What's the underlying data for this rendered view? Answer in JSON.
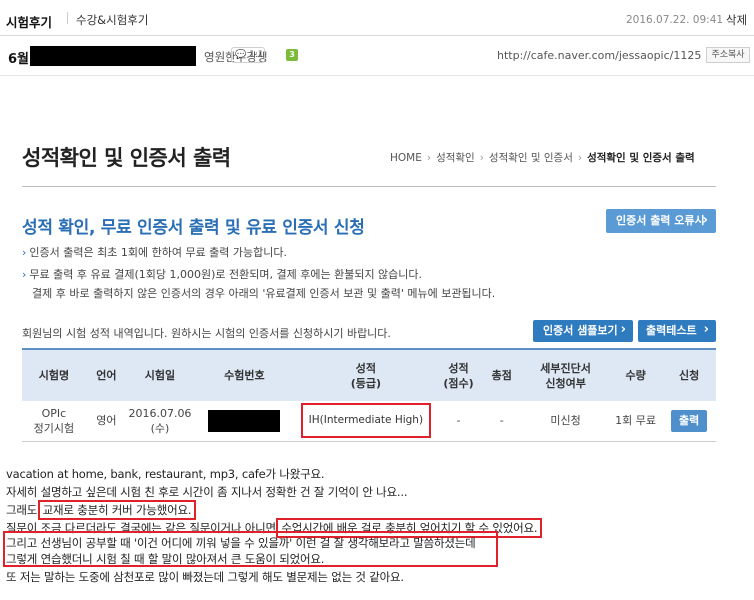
{
  "header": {
    "category": "시험후기",
    "subcategory": "수강&시험후기",
    "date": "2016.07.22. 09:41",
    "delete_label": "삭제"
  },
  "author": {
    "month": "6월",
    "role": "영원한수강생",
    "level_badge": "3",
    "chat_label": "1:1",
    "url": "http://cafe.naver.com/jessaopic/1125",
    "copy_label": "주소복사"
  },
  "embed": {
    "title": "성적확인 및 인증서 출력",
    "breadcrumb": [
      "HOME",
      "성적확인",
      "성적확인 및 인증서",
      "성적확인 및 인증서 출력"
    ],
    "heading": "성적 확인, 무료 인증서 출력 및 유료 인증서 신청",
    "error_button": "인증서 출력 오류시",
    "info_lines": [
      "인증서 출력은 최초 1회에 한하여 무료 출력 가능합니다.",
      "무료 출력 후 유료 결제(1회당 1,000원)로 전환되며, 결제 후에는 환불되지 않습니다.",
      "결제 후 바로 출력하지 않은 인증서의 경우 아래의 '유료결제 인증서 보관 및 출력' 메뉴에 보관됩니다."
    ],
    "member_note": "회원님의 시험 성적 내역입니다. 원하시는 시험의 인증서를 신청하시기 바랍니다.",
    "sample_button": "인증서 샘플보기",
    "test_button": "출력테스트",
    "table": {
      "headers": [
        "시험명",
        "언어",
        "시험일",
        "수험번호",
        "성적\n(등급)",
        "성적\n(점수)",
        "총점",
        "세부진단서\n신청여부",
        "수량",
        "신청"
      ],
      "row": {
        "exam": "OPIc\n정기시험",
        "language": "영어",
        "date": "2016.07.06\n(수)",
        "grade": "IH(Intermediate High)",
        "score": "-",
        "total": "-",
        "diagnosis": "미신청",
        "quantity": "1회 무료",
        "print_label": "출력"
      }
    }
  },
  "body": {
    "line1": "vacation at home, bank, restaurant, mp3, cafe가 나왔구요.",
    "line2": "자세히 설명하고 싶은데 시험 친 후로 시간이 좀 지나서 정확한 건 잘 기억이 안 나요...",
    "line3_pre": "그래도 ",
    "line3_hl": "교재로 충분히 커버 가능했어요.",
    "line4_pre": "질문이 조금 다르더라도 결국에는 같은 질문이거나 아니면 ",
    "line4_hl": "수업시간에 배운 걸로 충분히 엎어치기 할 수 있었어요.",
    "line5": "그리고 선생님이 공부할 때 '이건 어디에 끼워 넣을 수 있을까' 이런 걸 잘 생각해보라고 말씀하셨는데",
    "line6": "그렇게 연습했더니 시험 칠 때 할 말이 많아져서 큰 도움이 되었어요.",
    "line7": "또 저는 말하는 도중에 삼천포로 많이 빠졌는데 그렇게 해도 별문제는 없는 것 같아요."
  },
  "colors": {
    "accent_blue": "#2a6fb5",
    "highlight_red": "#e0202a"
  }
}
